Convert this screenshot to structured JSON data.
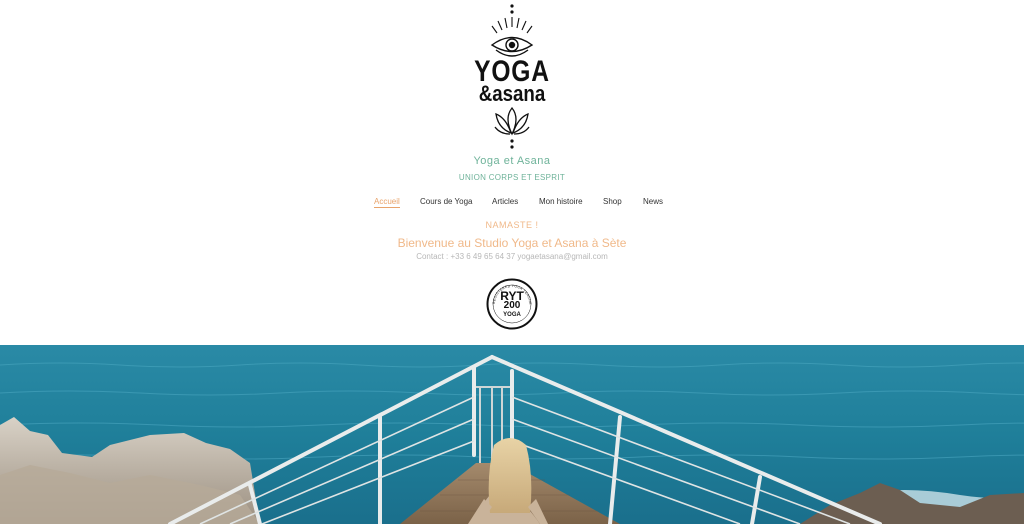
{
  "logo": {
    "word_yoga": "YOGA",
    "word_asana": "&asana",
    "registered": "®"
  },
  "site": {
    "title": "Yoga et Asana",
    "tagline": "UNION CORPS ET ESPRIT"
  },
  "nav": {
    "items": [
      {
        "label": "Accueil",
        "active": true
      },
      {
        "label": "Cours de Yoga",
        "active": false
      },
      {
        "label": "Articles",
        "active": false
      },
      {
        "label": "Mon histoire",
        "active": false
      },
      {
        "label": "Shop",
        "active": false
      },
      {
        "label": "News",
        "active": false
      }
    ]
  },
  "welcome": {
    "greeting": "NAMASTE !",
    "headline": "Bienvenue au Studio Yoga et Asana à Sète",
    "contact": "Contact : +33 6 49 65 64 37 yogaetasana@gmail.com"
  },
  "badge": {
    "line1": "RYT",
    "line2": "200",
    "line3": "YOGA",
    "ring_text": "REGISTERED YOGA TEACHER"
  },
  "colors": {
    "accent_orange": "#e8a36b",
    "accent_green": "#6fb39a",
    "sea": "#1f7f9a"
  },
  "icons": {
    "logo_eye": "eye-icon",
    "logo_lotus": "lotus-icon"
  }
}
